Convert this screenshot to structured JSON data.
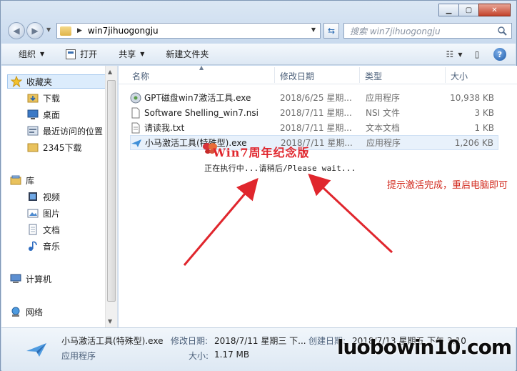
{
  "window": {
    "minimize_icon": "minimize-icon",
    "maximize_icon": "maximize-icon",
    "close_icon": "close-icon"
  },
  "address": {
    "path": "win7jihuogongju",
    "search_placeholder": "搜索 win7jihuogongju"
  },
  "toolbar": {
    "organize": "组织",
    "open": "打开",
    "share": "共享",
    "new_folder": "新建文件夹"
  },
  "sidebar": {
    "favorites": "收藏夹",
    "downloads": "下载",
    "desktop": "桌面",
    "recent": "最近访问的位置",
    "downloads_2345": "2345下载",
    "libraries": "库",
    "videos": "视频",
    "pictures": "图片",
    "documents": "文档",
    "music": "音乐",
    "computer": "计算机",
    "network": "网络"
  },
  "columns": {
    "name": "名称",
    "date": "修改日期",
    "type": "类型",
    "size": "大小"
  },
  "files": [
    {
      "name": "GPT磁盘win7激活工具.exe",
      "date": "2018/6/25 星期...",
      "type": "应用程序",
      "size": "10,938 KB"
    },
    {
      "name": "Software Shelling_win7.nsi",
      "date": "2018/7/11 星期...",
      "type": "NSI 文件",
      "size": "3 KB"
    },
    {
      "name": "请读我.txt",
      "date": "2018/7/11 星期...",
      "type": "文本文档",
      "size": "1 KB"
    },
    {
      "name": "小马激活工具(特殊型).exe",
      "date": "2018/7/11 星期...",
      "type": "应用程序",
      "size": "1,206 KB"
    }
  ],
  "overlay": {
    "title": "Win7周年纪念版",
    "status": "正在执行中...请稍后/Please wait..."
  },
  "annotation": "提示激活完成，重启电脑即可",
  "details": {
    "name": "小马激活工具(特殊型).exe",
    "kind": "应用程序",
    "modified_label": "修改日期:",
    "modified_value": "2018/7/11 星期三 下...",
    "created_label": "创建日期:",
    "created_value": "2018/7/13 星期五 下午 3:10",
    "size_label": "大小:",
    "size_value": "1.17 MB"
  },
  "watermark": "luobowin10.com",
  "colors": {
    "annotation": "#d22b1f",
    "overlay_title": "#e0262d",
    "selection": "#e8f1fb"
  }
}
